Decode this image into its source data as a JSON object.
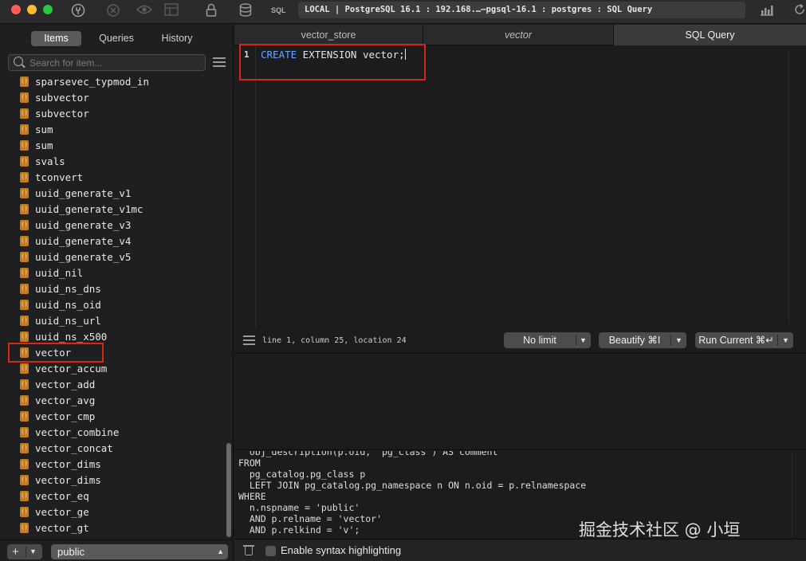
{
  "titlebar": {
    "sql_label": "SQL",
    "connection": "LOCAL | PostgreSQL 16.1 : 192.168.…—pgsql-16.1 : postgres : SQL Query"
  },
  "sidebar": {
    "segments": [
      "Items",
      "Queries",
      "History"
    ],
    "active_segment": "Items",
    "search_placeholder": "Search for item...",
    "items": [
      "sparsevec_typmod_in",
      "subvector",
      "subvector",
      "sum",
      "sum",
      "svals",
      "tconvert",
      "uuid_generate_v1",
      "uuid_generate_v1mc",
      "uuid_generate_v3",
      "uuid_generate_v4",
      "uuid_generate_v5",
      "uuid_nil",
      "uuid_ns_dns",
      "uuid_ns_oid",
      "uuid_ns_url",
      "uuid_ns_x500",
      "vector",
      "vector_accum",
      "vector_add",
      "vector_avg",
      "vector_cmp",
      "vector_combine",
      "vector_concat",
      "vector_dims",
      "vector_dims",
      "vector_eq",
      "vector_ge",
      "vector_gt"
    ],
    "item_badge": "()",
    "highlighted_item": "vector",
    "add_label": "+",
    "schema": "public"
  },
  "tabs": [
    {
      "label": "vector_store",
      "italic": false,
      "active": false
    },
    {
      "label": "vector",
      "italic": true,
      "active": false
    },
    {
      "label": "SQL Query",
      "italic": false,
      "active": true
    }
  ],
  "editor": {
    "line_number": "1",
    "keyword": "CREATE",
    "rest": " EXTENSION vector;",
    "cursor_info": "line 1, column 25, location 24"
  },
  "buttons": {
    "limit": "No limit",
    "beautify": "Beautify ⌘I",
    "run": "Run Current ⌘↵"
  },
  "console": {
    "text": "  obj_description(p.oid, 'pg_class') AS comment\nFROM\n  pg_catalog.pg_class p\n  LEFT JOIN pg_catalog.pg_namespace n ON n.oid = p.relnamespace\nWHERE\n  n.nspname = 'public'\n  AND p.relname = 'vector'\n  AND p.relkind = 'v';",
    "watermark": "掘金技术社区 @ 小垣"
  },
  "bottom": {
    "syntax_label": "Enable syntax highlighting"
  },
  "colors": {
    "highlight": "#d9261c",
    "keyword": "#69a6ff",
    "function_badge": "#c77a1a"
  }
}
